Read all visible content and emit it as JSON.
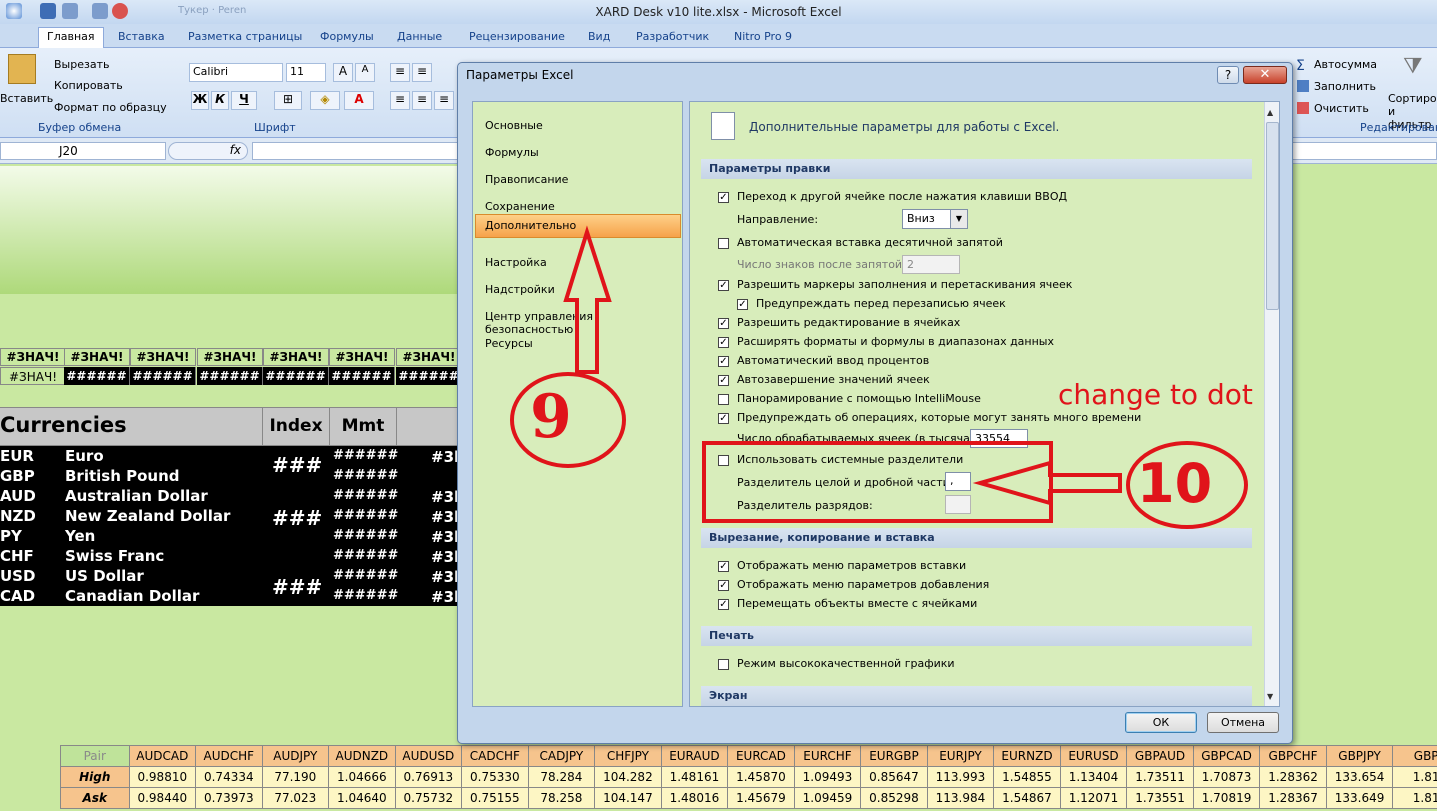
{
  "window": {
    "title": "XARD Desk v10 lite.xlsx - Microsoft Excel",
    "fade_text": "Тукер · Peren"
  },
  "tabs": [
    "Главная",
    "Вставка",
    "Разметка страницы",
    "Формулы",
    "Данные",
    "Рецензирование",
    "Вид",
    "Разработчик",
    "Nitro Pro 9"
  ],
  "ribbon": {
    "paste": "Вставить",
    "cut": "Вырезать",
    "copy": "Копировать",
    "format_painter": "Формат по образцу",
    "clipboard_group": "Буфер обмена",
    "font_name": "Calibri",
    "font_size": "11",
    "bold": "Ж",
    "italic": "К",
    "underline": "Ч",
    "font_group": "Шрифт",
    "autosum": "Автосумма",
    "fill": "Заполнить",
    "clear": "Очистить",
    "sort": "Сортиров",
    "sort2": "и фильтр",
    "edit_group": "Редактирован"
  },
  "formula_bar": {
    "name_box": "J20",
    "fx": "fx"
  },
  "sheet": {
    "err": "#ЗНАЧ!",
    "hash": "######",
    "err_left": "ЗНАЧ!",
    "currencies_header": "Currencies",
    "index_header": "Index",
    "mmt_header": "Mmt",
    "triple_hash": "###",
    "partial": "#3l",
    "currencies": [
      {
        "code": "EUR",
        "name": "Euro"
      },
      {
        "code": "GBP",
        "name": "British Pound"
      },
      {
        "code": "AUD",
        "name": "Australian Dollar"
      },
      {
        "code": "NZD",
        "name": "New Zealand Dollar"
      },
      {
        "code": "PY",
        "name": "Yen"
      },
      {
        "code": "CHF",
        "name": "Swiss Franc"
      },
      {
        "code": "USD",
        "name": "US Dollar"
      },
      {
        "code": "CAD",
        "name": "Canadian Dollar"
      }
    ],
    "bottom_table": {
      "corner": "Pair",
      "pairs": [
        "AUDCAD",
        "AUDCHF",
        "AUDJPY",
        "AUDNZD",
        "AUDUSD",
        "CADCHF",
        "CADJPY",
        "CHFJPY",
        "EURAUD",
        "EURCAD",
        "EURCHF",
        "EURGBP",
        "EURJPY",
        "EURNZD",
        "EURUSD",
        "GBPAUD",
        "GBPCAD",
        "GBPCHF",
        "GBPJPY",
        "GBP"
      ],
      "rows": [
        {
          "label": "High",
          "values": [
            "0.98810",
            "0.74334",
            "77.190",
            "1.04666",
            "0.76913",
            "0.75330",
            "78.284",
            "104.282",
            "1.48161",
            "1.45870",
            "1.09493",
            "0.85647",
            "113.993",
            "1.54855",
            "1.13404",
            "1.73511",
            "1.70873",
            "1.28362",
            "133.654",
            "1.81"
          ]
        },
        {
          "label": "Ask",
          "values": [
            "0.98440",
            "0.73973",
            "77.023",
            "1.04640",
            "0.75732",
            "0.75155",
            "78.258",
            "104.147",
            "1.48016",
            "1.45679",
            "1.09459",
            "0.85298",
            "113.984",
            "1.54867",
            "1.12071",
            "1.73551",
            "1.70819",
            "1.28367",
            "133.649",
            "1.81"
          ]
        }
      ]
    }
  },
  "dialog": {
    "title": "Параметры Excel",
    "help": "?",
    "close": "✕",
    "nav": [
      "Основные",
      "Формулы",
      "Правописание",
      "Сохранение",
      "Дополнительно",
      "Настройка",
      "Надстройки",
      "Центр управления безопасностью",
      "Ресурсы"
    ],
    "heading": "Дополнительные параметры для работы с Excel.",
    "sections": {
      "edit": "Параметры правки",
      "cut": "Вырезание, копирование и вставка",
      "print": "Печать",
      "screen": "Экран"
    },
    "options": {
      "enter_move": "Переход к другой ячейке после нажатия клавиши ВВОД",
      "direction": "Направление:",
      "direction_value": "Вниз",
      "auto_decimal": "Автоматическая вставка десятичной запятой",
      "decimal_places": "Число знаков после запятой:",
      "decimal_value": "2",
      "fill_handle": "Разрешить маркеры заполнения и перетаскивания ячеек",
      "warn_overwrite": "Предупреждать перед перезаписью ячеек",
      "edit_cells": "Разрешить редактирование в ячейках",
      "extend_formats": "Расширять форматы и формулы в диапазонах данных",
      "auto_percent": "Автоматический ввод процентов",
      "autocomplete": "Автозавершение значений ячеек",
      "intellimouse": "Панорамирование с помощью IntelliMouse",
      "warn_long": "Предупреждать об операциях, которые могут занять много времени",
      "cells_count": "Число обрабатываемых ячеек (в тысячах):",
      "cells_value": "33554",
      "system_sep": "Использовать системные разделители",
      "decimal_sep": "Разделитель целой и дробной части:",
      "decimal_sep_value": ",",
      "thousands_sep": "Разделитель разрядов:",
      "thousands_sep_value": "",
      "paste_menu": "Отображать меню параметров вставки",
      "insert_menu": "Отображать меню параметров добавления",
      "move_objects": "Перемещать объекты вместе с ячейками",
      "hq_graphics": "Режим высококачественной графики"
    },
    "ok": "ОК",
    "cancel": "Отмена"
  },
  "annotations": {
    "nine": "9",
    "ten": "10",
    "note": "change to dot",
    "color": "#e0141a"
  }
}
